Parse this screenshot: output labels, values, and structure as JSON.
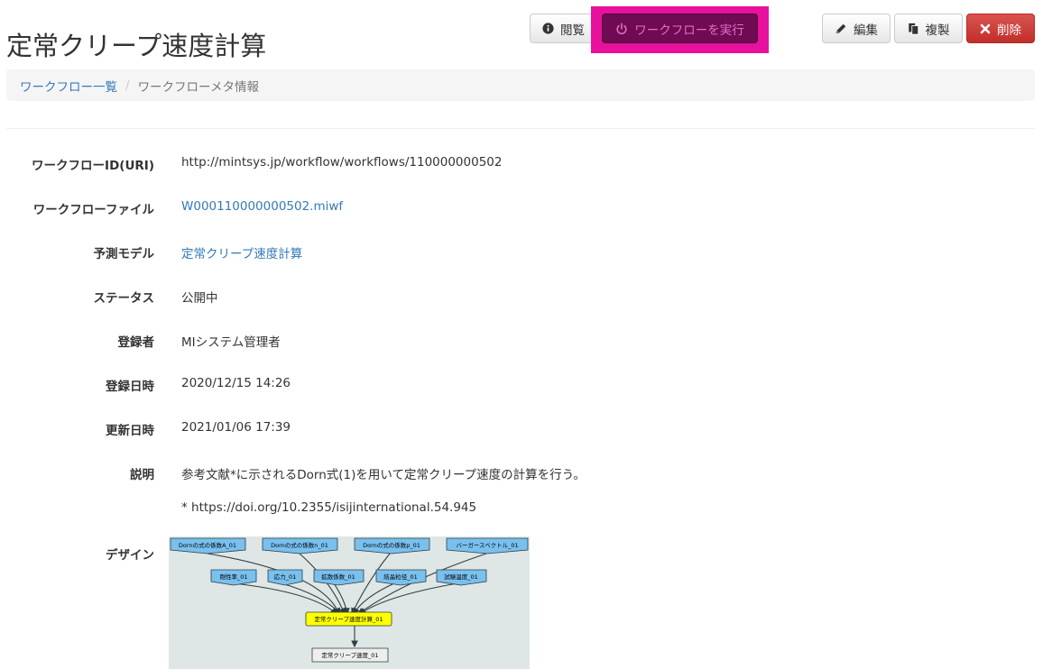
{
  "page": {
    "title": "定常クリープ速度計算"
  },
  "toolbar": {
    "view_label": "閲覧",
    "run_label": "ワークフローを実行",
    "edit_label": "編集",
    "copy_label": "複製",
    "delete_label": "削除"
  },
  "breadcrumb": {
    "items": [
      {
        "label": "ワークフロー一覧",
        "link": true
      },
      {
        "label": "ワークフローメタ情報",
        "link": false
      }
    ],
    "separator": "/"
  },
  "details": [
    {
      "label": "ワークフローID(URI)",
      "value": "http://mintsys.jp/workflow/workflows/110000000502",
      "link": false
    },
    {
      "label": "ワークフローファイル",
      "value": "W000110000000502.miwf",
      "link": true
    },
    {
      "label": "予測モデル",
      "value": "定常クリープ速度計算",
      "link": true
    },
    {
      "label": "ステータス",
      "value": "公開中",
      "link": false
    },
    {
      "label": "登録者",
      "value": "MIシステム管理者",
      "link": false
    },
    {
      "label": "登録日時",
      "value": "2020/12/15 14:26",
      "link": false
    },
    {
      "label": "更新日時",
      "value": "2021/01/06 17:39",
      "link": false
    },
    {
      "label": "説明",
      "value": "参考文献*に示されるDorn式(1)を用いて定常クリープ速度の計算を行う。",
      "link": false
    }
  ],
  "description_note": "* https://doi.org/10.2355/isijinternational.54.945",
  "design": {
    "label": "デザイン",
    "inputs_top": [
      "Dornの式の係数A_01",
      "Dornの式の係数n_01",
      "Dornの式の係数p_01",
      "バーガースベクトル_01"
    ],
    "inputs_mid": [
      "剛性率_01",
      "応力_01",
      "拡散係数_01",
      "結晶粒径_01",
      "試験温度_01"
    ],
    "tool": "定常クリープ速度計算_01",
    "output": "定常クリープ速度_01"
  },
  "colors": {
    "link": "#337ab7",
    "danger": "#d9534f",
    "highlight": "#e8119e",
    "run_button_bg": "#6e0b52",
    "input_node": "#79c0ef",
    "tool_node": "#ffff00",
    "output_node": "#eeeeee"
  },
  "icons": {
    "view": "info-circle-icon",
    "run": "power-icon",
    "edit": "pencil-icon",
    "copy": "copy-icon",
    "delete": "times-icon"
  }
}
